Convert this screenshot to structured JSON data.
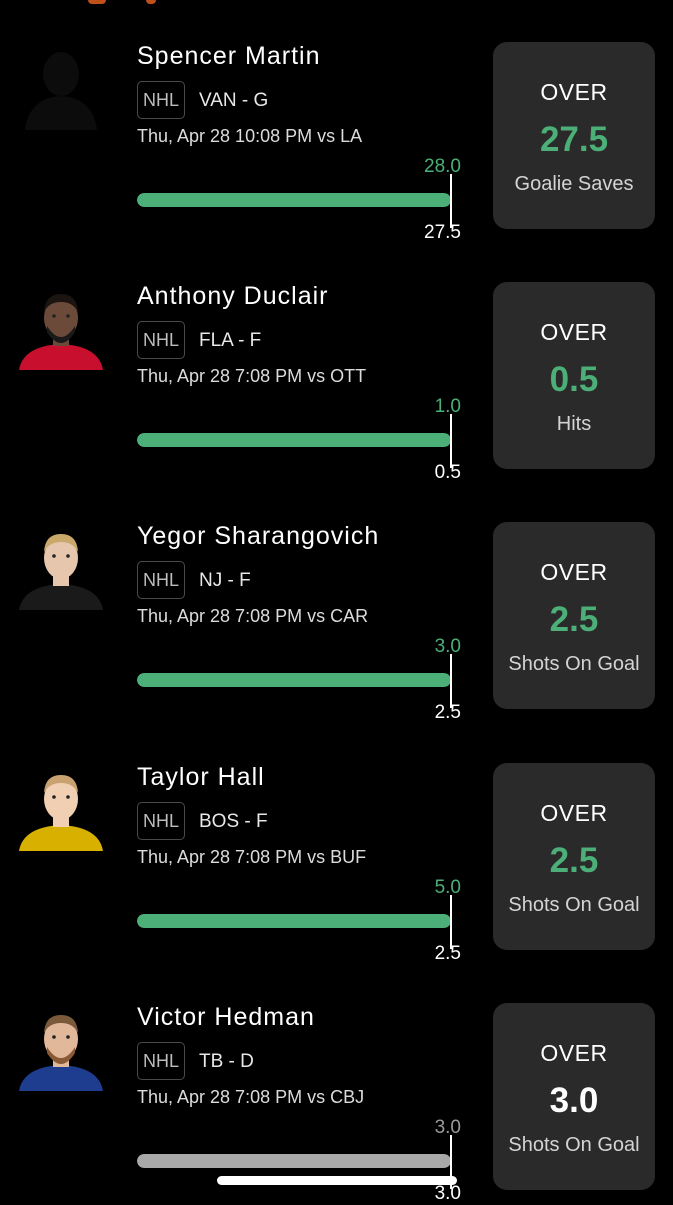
{
  "theme": {
    "background": "#000000",
    "card_background": "#2a2a2a",
    "accent_green": "#4caf78",
    "muted_gray": "#9a9a9a",
    "text_white": "#ffffff"
  },
  "players": [
    {
      "name": "Spencer Martin",
      "league": "NHL",
      "team_pos": "VAN - G",
      "game_info": "Thu, Apr 28 10:08 PM  vs LA",
      "bar_top": "28.0",
      "bar_bottom": "27.5",
      "bar_progress": 1.0,
      "bar_state": "won",
      "pick_direction": "OVER",
      "pick_line": "27.5",
      "pick_stat": "Goalie Saves",
      "avatar_icon": "silhouette-avatar-icon"
    },
    {
      "name": "Anthony Duclair",
      "league": "NHL",
      "team_pos": "FLA - F",
      "game_info": "Thu, Apr 28 7:08 PM  vs OTT",
      "bar_top": "1.0",
      "bar_bottom": "0.5",
      "bar_progress": 1.0,
      "bar_state": "won",
      "pick_direction": "OVER",
      "pick_line": "0.5",
      "pick_stat": "Hits",
      "avatar_icon": "player-headshot-icon"
    },
    {
      "name": "Yegor Sharangovich",
      "league": "NHL",
      "team_pos": "NJ - F",
      "game_info": "Thu, Apr 28 7:08 PM  vs CAR",
      "bar_top": "3.0",
      "bar_bottom": "2.5",
      "bar_progress": 1.0,
      "bar_state": "won",
      "pick_direction": "OVER",
      "pick_line": "2.5",
      "pick_stat": "Shots On Goal",
      "avatar_icon": "player-headshot-icon"
    },
    {
      "name": "Taylor Hall",
      "league": "NHL",
      "team_pos": "BOS - F",
      "game_info": "Thu, Apr 28 7:08 PM  vs BUF",
      "bar_top": "5.0",
      "bar_bottom": "2.5",
      "bar_progress": 1.0,
      "bar_state": "won",
      "pick_direction": "OVER",
      "pick_line": "2.5",
      "pick_stat": "Shots On Goal",
      "avatar_icon": "player-headshot-icon"
    },
    {
      "name": "Victor Hedman",
      "league": "NHL",
      "team_pos": "TB - D",
      "game_info": "Thu, Apr 28 7:08 PM  vs CBJ",
      "bar_top": "3.0",
      "bar_bottom": "3.0",
      "bar_progress": 1.0,
      "bar_state": "push",
      "pick_direction": "OVER",
      "pick_line": "3.0",
      "pick_stat": "Shots On Goal",
      "avatar_icon": "player-headshot-icon"
    }
  ]
}
